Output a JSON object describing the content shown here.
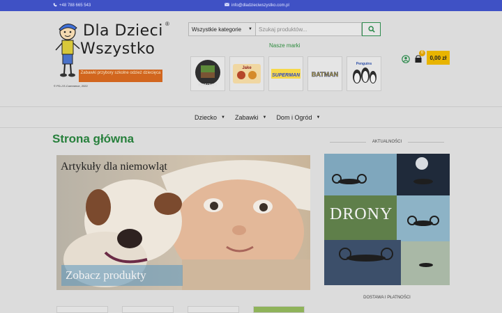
{
  "topbar": {
    "phone": "+48 788 665 543",
    "email": "info@dladzieciwszystko.com.pl"
  },
  "logo": {
    "line1": "Dla Dzieci",
    "line2": "Wszystko",
    "registered": "®",
    "tagline": "Zabawki przybory szkolne odzież dziecięca",
    "copyright": "© PD-J E-Commerce, 2022"
  },
  "search": {
    "category_label": "Wszystkie kategorie",
    "placeholder": "Szukaj produktów..."
  },
  "brands": {
    "title": "Nasze marki",
    "items": [
      "MINECRAFT",
      "Jake",
      "SUPERMAN",
      "BATMAN",
      "Penguins"
    ]
  },
  "cart": {
    "count": "0",
    "total": "0,00 zł"
  },
  "nav": {
    "items": [
      "Dziecko",
      "Zabawki",
      "Dom i Ogród"
    ]
  },
  "page": {
    "title": "Strona główna"
  },
  "banner": {
    "title": "Artykuły dla niemowląt",
    "cta": "Zobacz produkty"
  },
  "sidebar": {
    "news_heading": "AKTUALNOŚCI",
    "promo_title": "DRONY",
    "delivery_heading": "DOSTAWA I PŁATNOŚCI"
  },
  "colors": {
    "topbar": "#3f51c5",
    "accent_green": "#27803c",
    "cart_yellow": "#e8b400",
    "tag_orange": "#d2661e"
  }
}
